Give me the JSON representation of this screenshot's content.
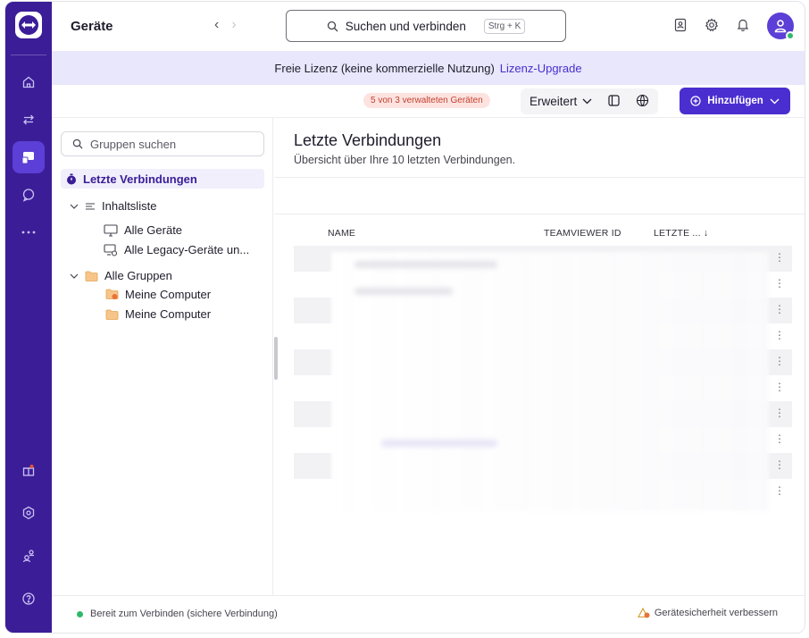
{
  "app": {
    "accent": "#3b1d98",
    "primary": "#4a2ed0"
  },
  "rail": {
    "items": [
      {
        "icon": "home-icon"
      },
      {
        "icon": "connections-icon"
      },
      {
        "icon": "devices-icon",
        "active": true
      },
      {
        "icon": "chat-icon"
      },
      {
        "icon": "more-icon"
      }
    ],
    "bottom": [
      {
        "icon": "gift-icon"
      },
      {
        "icon": "security-icon"
      },
      {
        "icon": "users-icon"
      },
      {
        "icon": "help-icon"
      }
    ]
  },
  "header": {
    "title": "Geräte",
    "search_label": "Suchen und verbinden",
    "search_shortcut": "Strg + K"
  },
  "banner": {
    "text": "Freie Lizenz (keine kommerzielle Nutzung)",
    "link": "Lizenz-Upgrade"
  },
  "toolbar": {
    "badge": "5 von 3 verwalteten Geräten",
    "view_label": "Erweitert",
    "add_label": "Hinzufügen"
  },
  "sidebar": {
    "search_placeholder": "Gruppen suchen",
    "recent": "Letzte Verbindungen",
    "content_list": "Inhaltsliste",
    "all_devices": "Alle Geräte",
    "legacy_devices": "Alle Legacy-Geräte un...",
    "all_groups": "Alle Gruppen",
    "group1": "Meine Computer",
    "group2": "Meine Computer"
  },
  "main": {
    "title": "Letzte Verbindungen",
    "subtitle": "Übersicht über Ihre 10 letzten Verbindungen.",
    "columns": {
      "name": "NAME",
      "id": "TEAMVIEWER ID",
      "last": "LETZTE ... ↓"
    },
    "rows": 10
  },
  "status": {
    "left": "Bereit zum Verbinden (sichere Verbindung)",
    "right": "Gerätesicherheit verbessern",
    "ok_color": "#2fb86a"
  }
}
